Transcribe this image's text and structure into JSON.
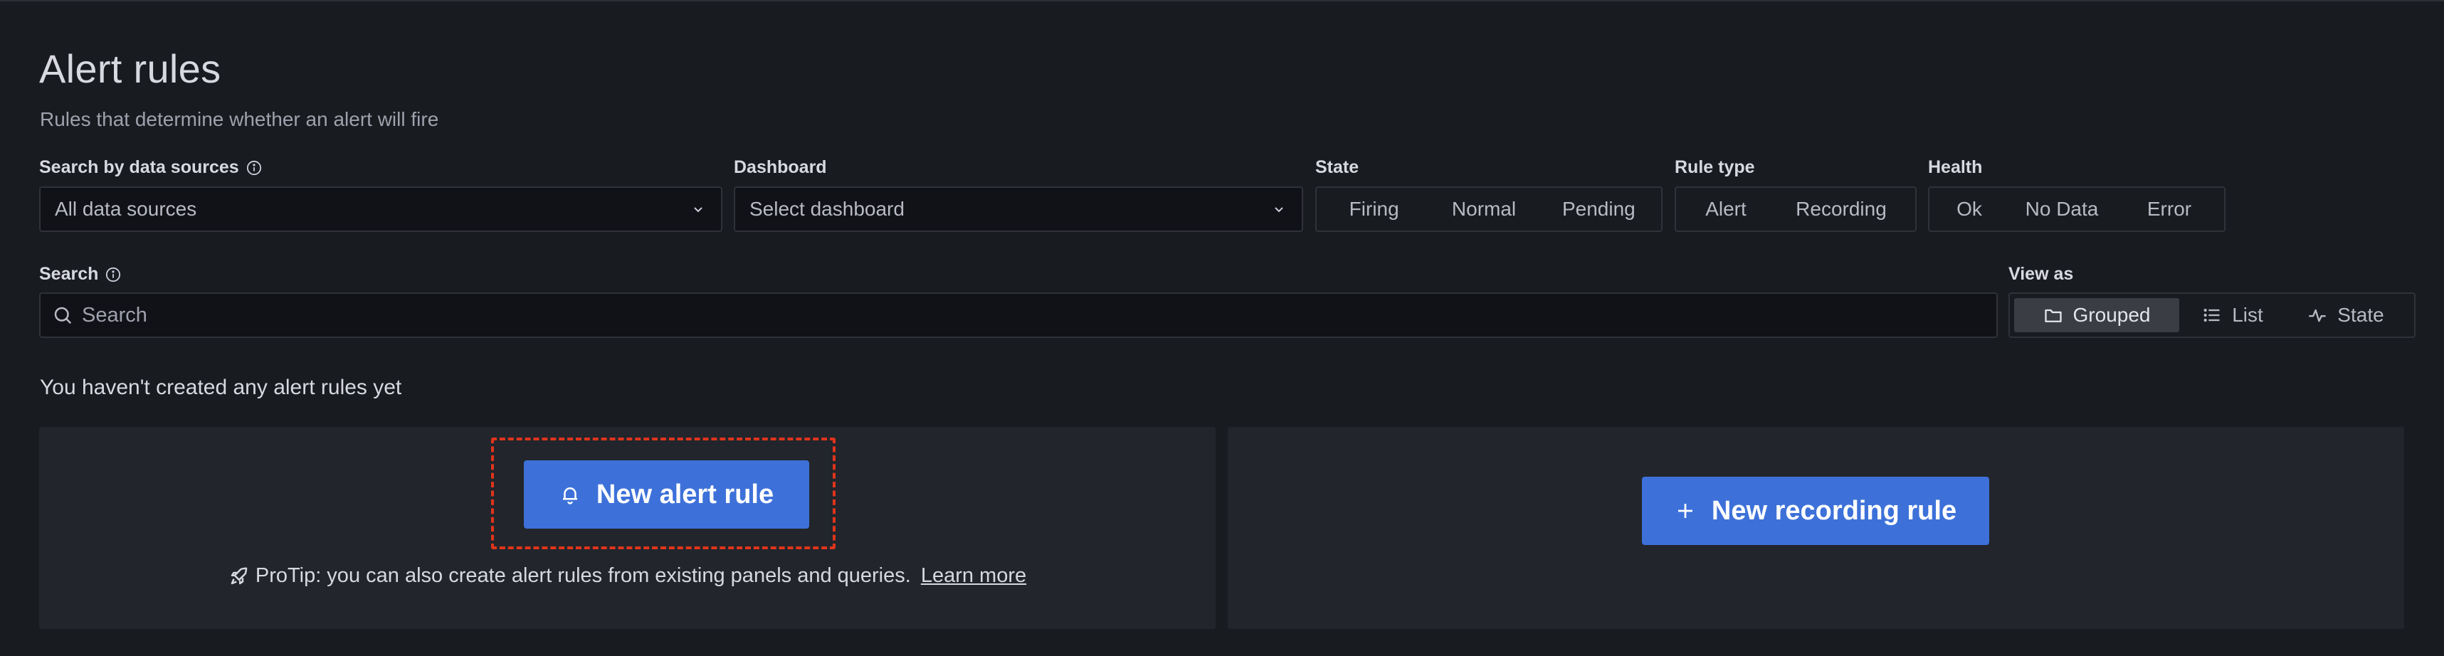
{
  "header": {
    "title": "Alert rules",
    "subtitle": "Rules that determine whether an alert will fire"
  },
  "filters": {
    "data_sources": {
      "label": "Search by data sources",
      "value": "All data sources",
      "icon": "info-icon"
    },
    "dashboard": {
      "label": "Dashboard",
      "placeholder": "Select dashboard"
    },
    "state": {
      "label": "State",
      "options": [
        "Firing",
        "Normal",
        "Pending"
      ]
    },
    "rule_type": {
      "label": "Rule type",
      "options": [
        "Alert",
        "Recording"
      ]
    },
    "health": {
      "label": "Health",
      "options": [
        "Ok",
        "No Data",
        "Error"
      ]
    }
  },
  "search": {
    "label": "Search",
    "placeholder": "Search",
    "value": ""
  },
  "view_as": {
    "label": "View as",
    "options": [
      {
        "label": "Grouped",
        "icon": "folder-icon",
        "active": true
      },
      {
        "label": "List",
        "icon": "list-icon",
        "active": false
      },
      {
        "label": "State",
        "icon": "heart-rate-icon",
        "active": false
      }
    ]
  },
  "empty_state": {
    "message": "You haven't created any alert rules yet",
    "new_alert_button": "New alert rule",
    "new_recording_button": "New recording rule",
    "protip_text": "ProTip: you can also create alert rules from existing panels and queries.",
    "learn_more": "Learn more"
  },
  "colors": {
    "background": "#181b1f",
    "card": "#22252b",
    "primary_button": "#3d71d9",
    "highlight": "#e0341c"
  }
}
